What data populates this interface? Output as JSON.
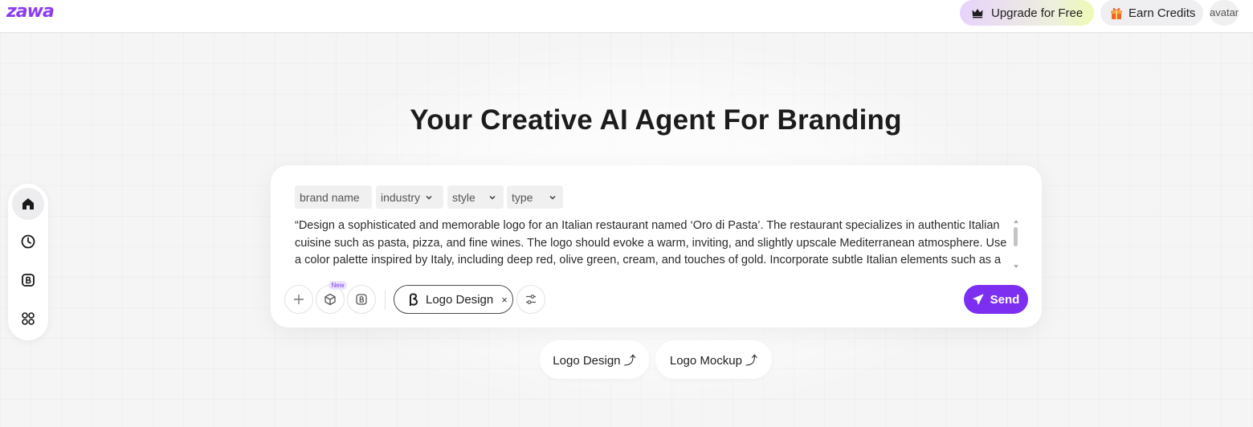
{
  "brand": {
    "logo_text": "zawa",
    "accent": "#7c2ff0"
  },
  "header": {
    "upgrade_label": "Upgrade for Free",
    "earn_label": "Earn Credits",
    "avatar_alt": "avatar"
  },
  "sidebar": {
    "items": [
      {
        "icon": "home-icon",
        "active": true
      },
      {
        "icon": "clock-icon",
        "active": false
      },
      {
        "icon": "brand-b-icon",
        "active": false
      },
      {
        "icon": "apps-grid-icon",
        "active": false
      }
    ]
  },
  "main": {
    "title": "Your Creative AI Agent For Branding",
    "chips": [
      {
        "label": "brand name",
        "has_dropdown": false
      },
      {
        "label": "industry",
        "has_dropdown": true
      },
      {
        "label": "style",
        "has_dropdown": true
      },
      {
        "label": "type",
        "has_dropdown": true
      }
    ],
    "prompt_text": "“Design a sophisticated and memorable logo for an Italian restaurant named ‘Oro di Pasta’. The restaurant specializes in authentic Italian cuisine such as pasta, pizza, and fine wines. The logo should evoke a warm, inviting, and slightly upscale Mediterranean atmosphere. Use a color palette inspired by Italy, including deep red, olive green, cream, and touches of gold. Incorporate subtle Italian elements such as a",
    "tools": {
      "add_icon": "plus-icon",
      "cube_icon": "cube-icon",
      "brand_icon": "brand-b-icon",
      "new_badge": "New",
      "settings_icon": "sliders-icon"
    },
    "agent_pill": {
      "label": "Logo Design",
      "remove": "×"
    },
    "send_label": "Send"
  },
  "quick_links": [
    {
      "label": "Logo Design ⤴"
    },
    {
      "label": "Logo Mockup ⤴"
    }
  ]
}
